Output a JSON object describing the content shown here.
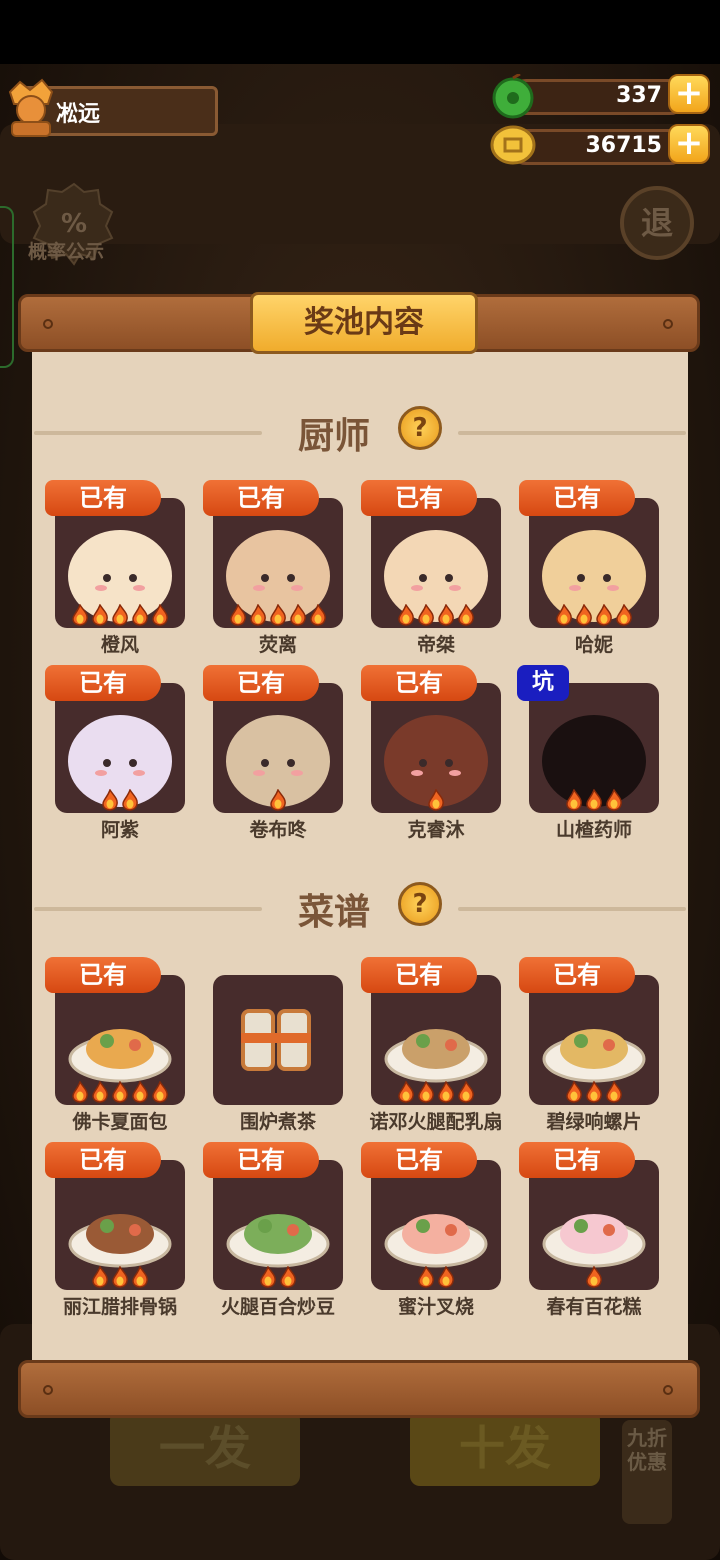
{
  "player": {
    "name": "凇远"
  },
  "resources": [
    {
      "icon": "jade-icon",
      "value": "337"
    },
    {
      "icon": "coin-icon",
      "value": "36715"
    }
  ],
  "plus_label": "+",
  "probability": {
    "label": "概率公示",
    "symbol": "%"
  },
  "back": {
    "label": "退"
  },
  "bottom": {
    "single": "一发",
    "ten": "十发",
    "discount": "九折优惠"
  },
  "modal": {
    "title": "奖池内容",
    "help_symbol": "?",
    "owned_label": "已有",
    "new_label": "坑",
    "sections": [
      {
        "title": "厨师",
        "items": [
          {
            "name": "橙风",
            "owned": true,
            "stars": 5
          },
          {
            "name": "荧离",
            "owned": true,
            "stars": 5
          },
          {
            "name": "帝桀",
            "owned": true,
            "stars": 4
          },
          {
            "name": "哈妮",
            "owned": true,
            "stars": 4
          },
          {
            "name": "阿紫",
            "owned": true,
            "stars": 2
          },
          {
            "name": "卷布咚",
            "owned": true,
            "stars": 1
          },
          {
            "name": "克睿沐",
            "owned": true,
            "stars": 1
          },
          {
            "name": "山楂药师",
            "owned": false,
            "stars": 3
          }
        ]
      },
      {
        "title": "菜谱",
        "items": [
          {
            "name": "佛卡夏面包",
            "owned": true,
            "stars": 5
          },
          {
            "name": "围炉煮茶",
            "owned": false,
            "stars": 0
          },
          {
            "name": "诺邓火腿配乳扇",
            "owned": true,
            "stars": 4
          },
          {
            "name": "碧绿响螺片",
            "owned": true,
            "stars": 3
          },
          {
            "name": "丽江腊排骨锅",
            "owned": true,
            "stars": 3
          },
          {
            "name": "火腿百合炒豆",
            "owned": true,
            "stars": 2
          },
          {
            "name": "蜜汁叉烧",
            "owned": true,
            "stars": 2
          },
          {
            "name": "春有百花糕",
            "owned": true,
            "stars": 1
          }
        ]
      }
    ]
  },
  "colors": {
    "badge": "#e0561c",
    "card": "#472c2c",
    "paper": "#e5d3bb",
    "wood": "#9a5a2e",
    "new_badge": "#1a1ec0"
  }
}
